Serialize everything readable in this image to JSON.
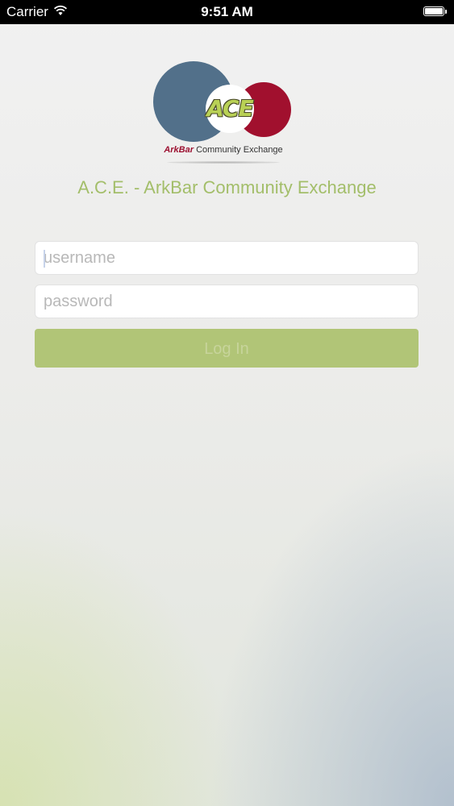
{
  "status_bar": {
    "carrier": "Carrier",
    "time": "9:51 AM",
    "icons": [
      "wifi-icon",
      "battery-icon"
    ]
  },
  "logo": {
    "badge_text": "ACE",
    "brand_prefix": "ArkBar",
    "brand_suffix": "Community Exchange"
  },
  "title": "A.C.E. - ArkBar Community Exchange",
  "form": {
    "username_placeholder": "username",
    "username_value": "",
    "password_placeholder": "password",
    "password_value": "",
    "login_label": "Log In"
  },
  "colors": {
    "accent_green": "#a3be6a",
    "button_green": "#b1c577",
    "logo_blue": "#52708a",
    "logo_red": "#a1102e"
  }
}
